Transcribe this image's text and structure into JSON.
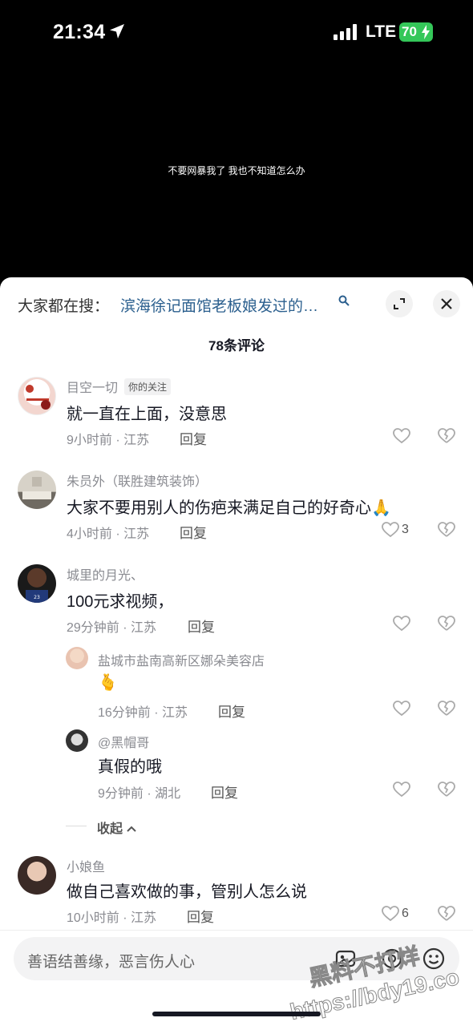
{
  "status": {
    "time": "21:34",
    "network": "LTE",
    "battery": "70"
  },
  "video": {
    "subtitle": "不要网暴我了 我也不知道怎么办"
  },
  "sheet": {
    "search_prefix": "大家都在搜：",
    "search_term": "滨海徐记面馆老板娘发过的…",
    "comment_count": "78条评论"
  },
  "comments": [
    {
      "user": "目空一切",
      "tag": "你的关注",
      "text": "就一直在上面，没意思",
      "time": "9小时前 · 江苏",
      "reply": "回复",
      "likes": ""
    },
    {
      "user": "朱员外（联胜建筑装饰）",
      "text": "大家不要用别人的伤疤来满足自己的好奇心🙏",
      "time": "4小时前 · 江苏",
      "reply": "回复",
      "likes": "3"
    },
    {
      "user": "城里的月光、",
      "text": "100元求视频，",
      "time": "29分钟前 · 江苏",
      "reply": "回复",
      "likes": ""
    },
    {
      "user": "盐城市盐南高新区娜朵美容店",
      "text": "🫰",
      "time": "16分钟前 · 江苏",
      "reply": "回复",
      "likes": ""
    },
    {
      "user": "@黑帽哥",
      "text": "真假的哦",
      "time": "9分钟前 · 湖北",
      "reply": "回复",
      "likes": ""
    },
    {
      "user": "小娘鱼",
      "text": "做自己喜欢做的事，管别人怎么说",
      "time": "10小时前 · 江苏",
      "reply": "回复",
      "likes": "6"
    }
  ],
  "collapse_label": "收起",
  "input": {
    "placeholder": "善语结善缘，恶言伤人心"
  },
  "watermark": {
    "line1": "黑料不打烊",
    "line2": "https://bdy19.co"
  },
  "colors": {
    "link": "#2b5f8e",
    "battery": "#34c759",
    "meta": "#8a8b91"
  }
}
